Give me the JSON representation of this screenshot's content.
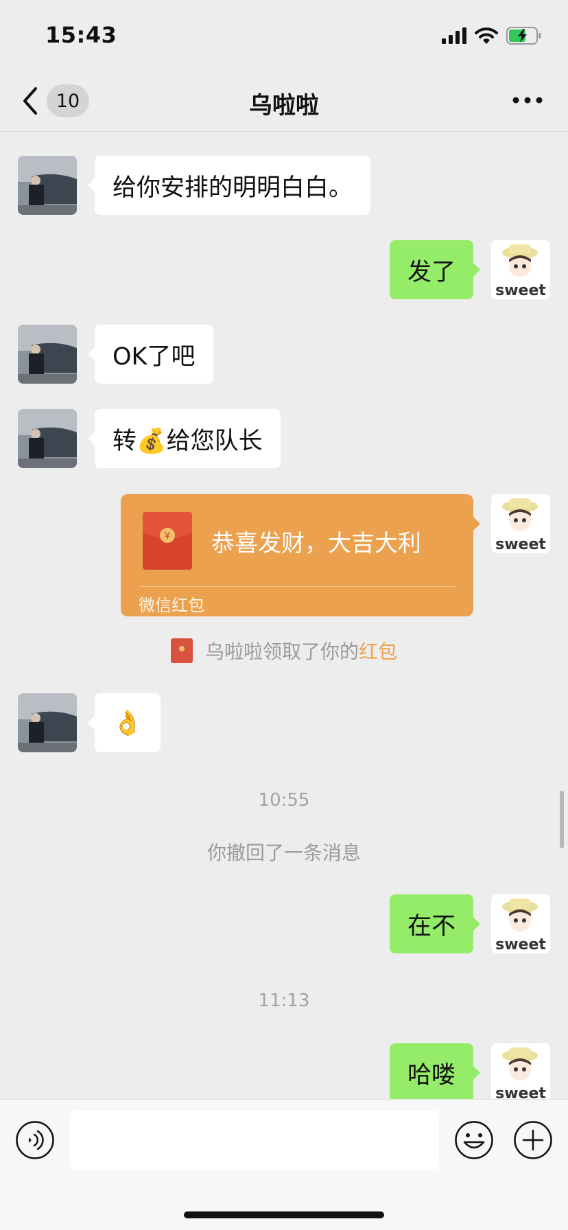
{
  "status_bar": {
    "time": "15:43"
  },
  "nav": {
    "unread_count": "10",
    "title": "乌啦啦"
  },
  "messages": [
    {
      "side": "in",
      "text": "给你安排的明明白白。"
    },
    {
      "side": "out",
      "text": "发了"
    },
    {
      "side": "in",
      "text": "OK了吧"
    },
    {
      "side": "in",
      "text": "转💰给您队长"
    },
    {
      "side": "in",
      "text": "👌"
    },
    {
      "side": "out",
      "text": "在不"
    },
    {
      "side": "out",
      "text": "哈喽"
    }
  ],
  "red_packet": {
    "title": "恭喜发财，大吉大利",
    "footer": "微信红包",
    "symbol": "¥",
    "color": "#eca14e"
  },
  "notices": {
    "packet_claimed_prefix": "乌啦啦领取了你的",
    "packet_claimed_highlight": "红包",
    "recall": "你撤回了一条消息"
  },
  "timestamps": [
    "10:55",
    "11:13"
  ],
  "avatars": {
    "self_caption": "sweet"
  },
  "colors": {
    "bubble_out": "#95ec69",
    "bubble_in": "#ffffff",
    "highlight": "#f0a04b"
  },
  "input": {
    "value": "",
    "placeholder": ""
  }
}
